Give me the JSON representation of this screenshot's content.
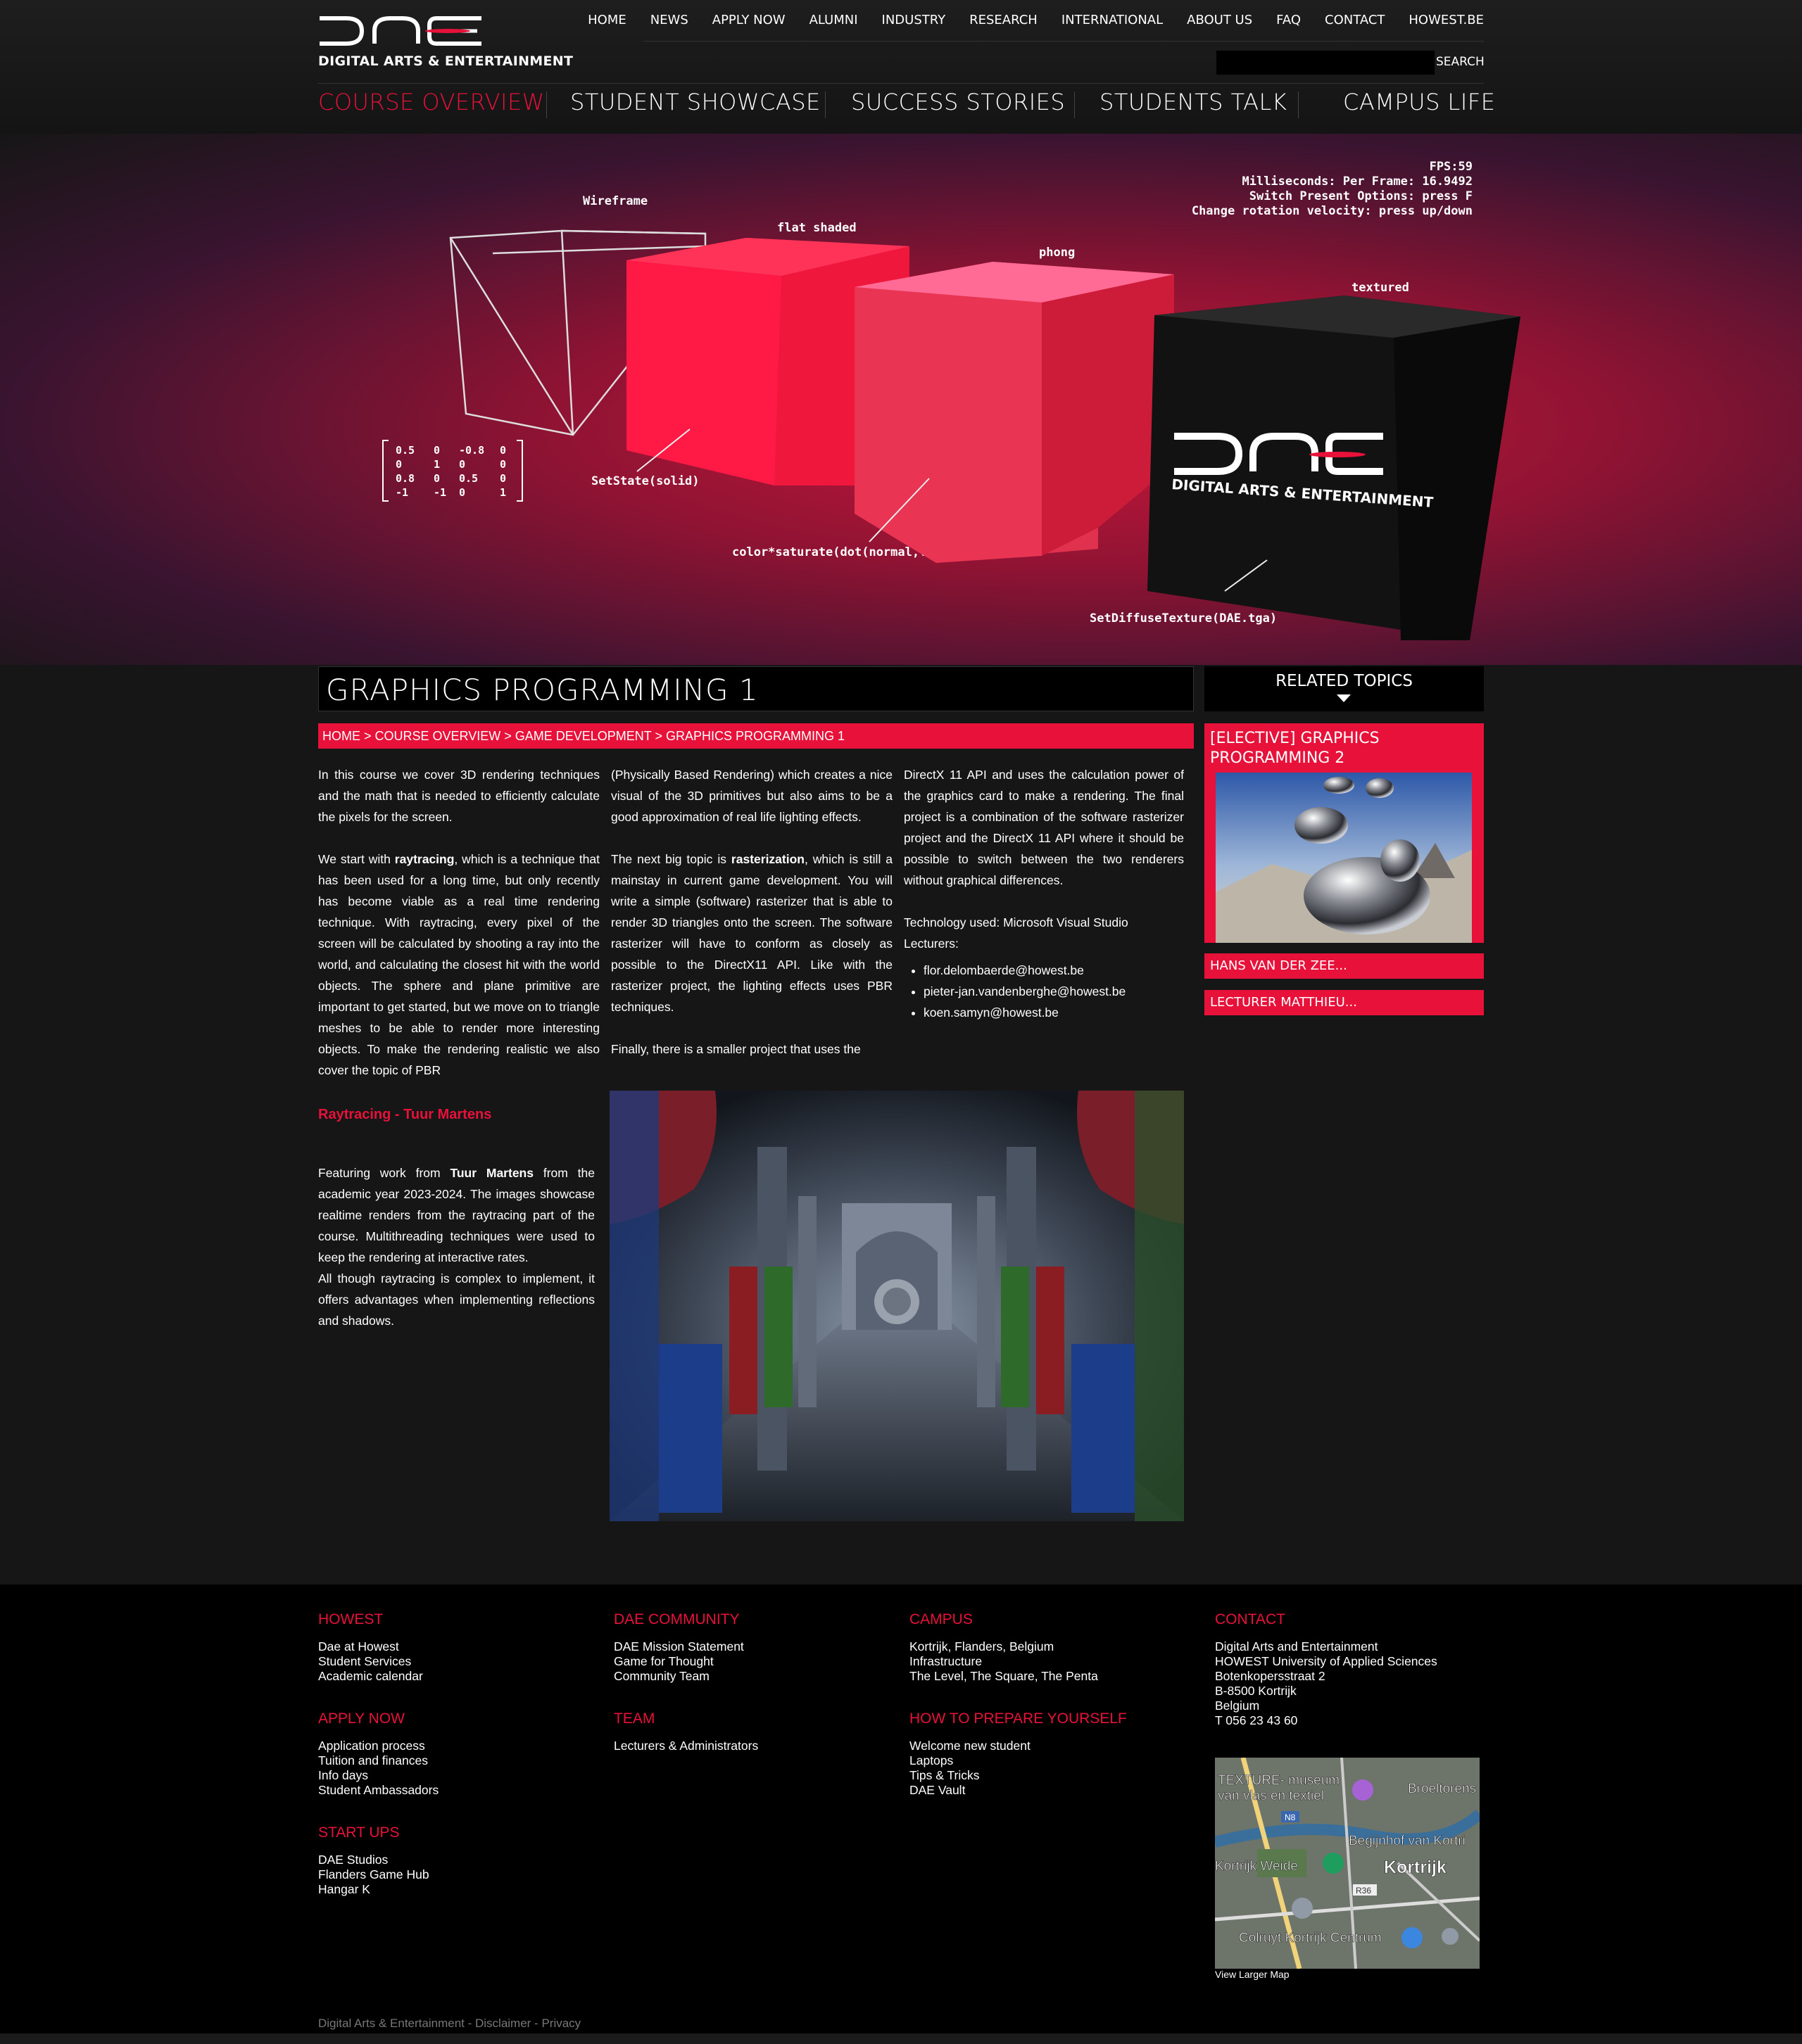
{
  "header": {
    "logo_text": "DIGITAL ARTS & ENTERTAINMENT",
    "top_nav": [
      "HOME",
      "NEWS",
      "APPLY NOW",
      "ALUMNI",
      "INDUSTRY",
      "RESEARCH",
      "INTERNATIONAL",
      "ABOUT US",
      "FAQ",
      "CONTACT",
      "HOWEST.BE"
    ],
    "search_label": "SEARCH",
    "search_value": "",
    "main_nav": [
      {
        "label": "COURSE OVERVIEW",
        "active": true
      },
      {
        "label": "STUDENT SHOWCASE"
      },
      {
        "label": "SUCCESS STORIES"
      },
      {
        "label": "STUDENTS TALK"
      },
      {
        "label": "CAMPUS LIFE"
      }
    ]
  },
  "hero": {
    "fps": "FPS:59",
    "ms": "Milliseconds: Per Frame: 16.9492",
    "switch": "Switch Present Options: press F",
    "rotation": "Change rotation velocity: press up/down",
    "label_wireframe": "Wireframe",
    "label_flat": "flat shaded",
    "label_phong": "phong",
    "label_textured": "textured",
    "code_setstate": "SetState(solid)",
    "code_color": "color*saturate(dot(normal,lightDir))",
    "code_texture": "SetDiffuseTexture(DAE.tga)",
    "matrix": [
      [
        "0.5",
        "0",
        "-0.8",
        "0"
      ],
      [
        "0",
        "1",
        "0",
        "0"
      ],
      [
        "0.8",
        "0",
        "0.5",
        "0"
      ],
      [
        "-1",
        "-1",
        "0",
        "1"
      ]
    ],
    "cube_logo_text": "DIGITAL ARTS & ENTERTAINMENT"
  },
  "page": {
    "title": "GRAPHICS PROGRAMMING 1",
    "breadcrumb": [
      "HOME",
      "COURSE OVERVIEW",
      "GAME DEVELOPMENT",
      "GRAPHICS PROGRAMMING 1"
    ],
    "breadcrumb_sep": " > "
  },
  "content": {
    "p1": "In this course we cover 3D rendering techniques and the math that is needed to efficiently calculate the pixels for the screen.",
    "p2_a": "We start with ",
    "p2_b": "raytracing",
    "p2_c": ", which is a technique that has been used for a long time, but only recently has become viable as a real time rendering technique. With raytracing, every pixel of the screen will be calculated by shooting a ray into the world, and calculating the closest hit with the world objects. The sphere and plane primitive are important to get started, but we move on to triangle meshes to be able to render more interesting objects. To make the rendering realistic we also cover the topic of PBR",
    "p3": "(Physically Based Rendering) which creates a nice visual of the 3D primitives but also aims to be a good approximation of real life lighting effects.",
    "p4_a": "The next big topic is ",
    "p4_b": "rasterization",
    "p4_c": ", which is still a mainstay in current game development. You will write a simple (software) rasterizer that is able to render 3D triangles onto the screen. The software rasterizer will have to conform as closely as possible to the DirectX11 API. Like with the rasterizer project, the lighting effects uses PBR techniques.",
    "p5": "Finally, there is a smaller project that uses the",
    "p6": "DirectX 11 API and uses the calculation power of the graphics card to make a rendering. The final project is a combination of the software rasterizer project and the DirectX 11 API where it should be possible to switch between the two renderers without graphical differences.",
    "tech": "Technology used: Microsoft Visual Studio",
    "lecturers_label": "Lecturers:",
    "lecturers": [
      "flor.delombaerde@howest.be",
      "pieter-jan.vandenberghe@howest.be",
      "koen.samyn@howest.be"
    ]
  },
  "showcase": {
    "heading": "Raytracing - Tuur Martens",
    "t1": "Featuring work from ",
    "t2": "Tuur Martens",
    "t3": " from the academic year 2023-2024. The images showcase realtime renders from the raytracing part of the course. Multithreading techniques were used to keep the rendering at interactive rates.",
    "t4": "All though raytracing is complex to implement, it offers advantages when implementing reflections and shadows."
  },
  "related": {
    "title": "RELATED TOPICS",
    "card_title": "[ELECTIVE] GRAPHICS PROGRAMMING 2",
    "items": [
      "HANS VAN DER ZEE...",
      "LECTURER MATTHIEU..."
    ]
  },
  "footer": {
    "howest": {
      "title": "HOWEST",
      "links": [
        "Dae at Howest",
        "Student Services",
        "Academic calendar"
      ]
    },
    "apply": {
      "title": "APPLY NOW",
      "links": [
        "Application process",
        "Tuition and finances",
        "Info days",
        "Student Ambassadors"
      ]
    },
    "startups": {
      "title": "START UPS",
      "links": [
        "DAE Studios",
        "Flanders Game Hub",
        "Hangar K"
      ]
    },
    "community": {
      "title": "DAE COMMUNITY",
      "links": [
        "DAE Mission Statement",
        "Game for Thought",
        "Community Team"
      ]
    },
    "team": {
      "title": "TEAM",
      "links": [
        "Lecturers & Administrators"
      ]
    },
    "campus": {
      "title": "CAMPUS",
      "links": [
        "Kortrijk, Flanders, Belgium",
        "Infrastructure",
        "The Level, The Square, The Penta"
      ]
    },
    "prepare": {
      "title": "HOW TO PREPARE YOURSELF",
      "links": [
        "Welcome new student",
        "Laptops",
        "Tips & Tricks",
        "DAE Vault"
      ]
    },
    "contact": {
      "title": "CONTACT",
      "lines": [
        "Digital Arts and Entertainment",
        "HOWEST University of Applied Sciences",
        "Botenkopersstraat 2",
        "B-8500 Kortrijk",
        "Belgium",
        "T 056 23 43 60"
      ]
    },
    "map": {
      "labels": [
        "TEXTURE- museum",
        "van vlas en textiel",
        "Broeltorens",
        "Begijnhof van Kortri",
        "Kortrijk Weide",
        "Kortrijk",
        "Colruyt Kortrijk Centrum",
        "N8",
        "R36"
      ],
      "link": "View Larger Map"
    },
    "legal": [
      "Digital Arts & Entertainment",
      "Disclaimer",
      "Privacy"
    ],
    "legal_sep": " - "
  },
  "colors": {
    "accent": "#e8113a",
    "background": "#161616",
    "footer": "#000000"
  }
}
